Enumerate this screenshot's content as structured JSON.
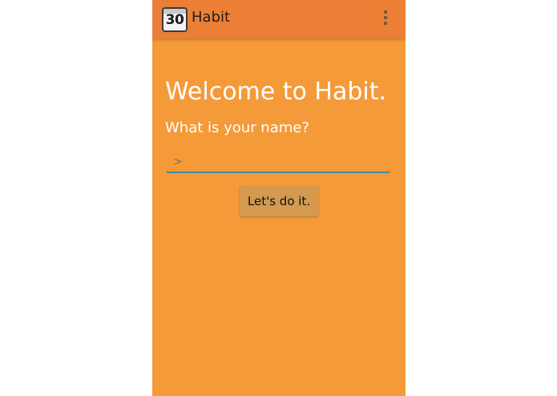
{
  "app": {
    "icon_text": "30",
    "title": "Habit"
  },
  "main": {
    "welcome": "Welcome to Habit.",
    "question": "What is your name?",
    "name_input": {
      "value": "",
      "placeholder": ">"
    },
    "submit_label": "Let's do it."
  },
  "icons": {
    "app_icon": "calendar-30-icon",
    "overflow": "overflow-menu-icon"
  },
  "colors": {
    "background": "#f59a38",
    "action_bar": "#ec7f36",
    "button": "#d39a50",
    "input_underline": "#3e8fa8"
  }
}
